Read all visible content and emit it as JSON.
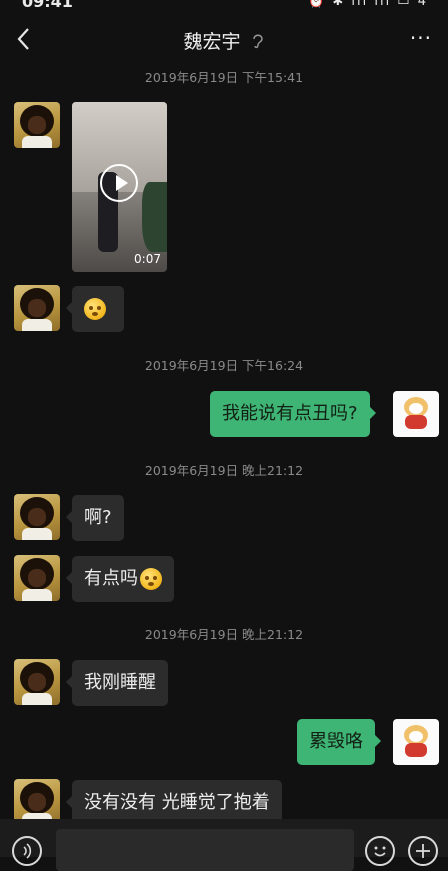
{
  "status_bar": {
    "time": "09:41",
    "icons": "⏰ ✱ ıll ıll ▭ 4"
  },
  "header": {
    "title": "魏宏宇",
    "more": "···"
  },
  "timestamps": [
    "2019年6月19日 下午15:41",
    "2019年6月19日 下午16:24",
    "2019年6月19日 晚上21:12",
    "2019年6月19日 晚上21:12"
  ],
  "messages": {
    "video_duration": "0:07",
    "m_right_1": "我能说有点丑吗?",
    "m_left_1": "啊?",
    "m_left_2": "有点吗",
    "m_left_3": "我刚睡醒",
    "m_right_2": "累毁咯",
    "m_left_4": "没有没有 光睡觉了抱着"
  },
  "avatar_right_caption": "",
  "colors": {
    "background": "#111111",
    "bubble_left": "#2c2c2c",
    "bubble_right": "#3eb575"
  },
  "icons": [
    "back-icon",
    "ear-icon",
    "more-icon",
    "play-icon",
    "voice-icon",
    "emoji-icon",
    "plus-icon"
  ]
}
